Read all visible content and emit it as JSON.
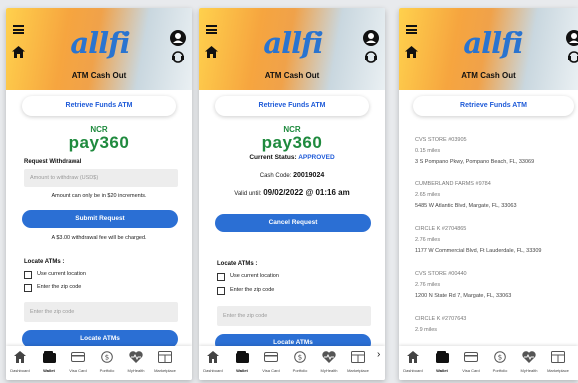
{
  "app": {
    "logo_text": "allfi",
    "header_title": "ATM Cash Out",
    "retrieve_label": "Retrieve Funds ATM",
    "ncr_top": "NCR",
    "ncr_bottom": "pay360"
  },
  "screen1": {
    "request_heading": "Request Withdrawal",
    "amount_placeholder": "Amount to withdraw (USD$)",
    "increments_note": "Amount can only be in $20 increments.",
    "submit_label": "Submit Request",
    "fee_note": "A $3.00 withdrawal fee will be charged.",
    "locate_heading": "Locate ATMs :",
    "use_location_label": "Use current location",
    "zip_label": "Enter the zip code",
    "zip_placeholder": "Enter the zip code",
    "locate_button": "Locate ATMs"
  },
  "screen2": {
    "status_label": "Current Status: ",
    "status_value": "APPROVED",
    "code_label": "Cash Code: ",
    "code_value": "20019024",
    "valid_label": "Valid until: ",
    "valid_value": "09/02/2022 @ 01:16 am",
    "cancel_label": "Cancel Request",
    "locate_heading": "Locate ATMs :",
    "use_location_label": "Use current location",
    "zip_label": "Enter the zip code",
    "zip_placeholder": "Enter the zip code",
    "locate_button": "Locate ATMs"
  },
  "screen3": {
    "locations": [
      {
        "name": "CVS STORE #03905",
        "distance": "0.15 miles",
        "address": "3 S Pompano Pkwy, Pompano Beach, FL, 33069"
      },
      {
        "name": "CUMBERLAND FARMS #9784",
        "distance": "2.65 miles",
        "address": "5485 W Atlantic Blvd, Margate, FL, 33063"
      },
      {
        "name": "CIRCLE K #2704865",
        "distance": "2.76 miles",
        "address": "1177 W Commercial Blvd, Ft Lauderdale, FL, 33309"
      },
      {
        "name": "CVS STORE #00440",
        "distance": "2.76 miles",
        "address": "1200 N State Rd 7, Margate, FL, 33063"
      },
      {
        "name": "CIRCLE K #2707643",
        "distance": "2.9 miles",
        "address": ""
      }
    ]
  },
  "nav": [
    {
      "label": "Dashboard",
      "icon": "home-icon"
    },
    {
      "label": "Wallet",
      "icon": "wallet-icon",
      "active": true
    },
    {
      "label": "Visa Card",
      "icon": "card-icon"
    },
    {
      "label": "Portfolio",
      "icon": "dollar-coin-icon"
    },
    {
      "label": "MyHealth",
      "icon": "heart-icon"
    },
    {
      "label": "Marketplace",
      "icon": "market-icon"
    }
  ],
  "colors": {
    "accent_blue": "#2b6fd4",
    "logo_blue": "#2a74d0",
    "ncr_green": "#1f8a3e",
    "header_orange": "#f6a53f"
  }
}
